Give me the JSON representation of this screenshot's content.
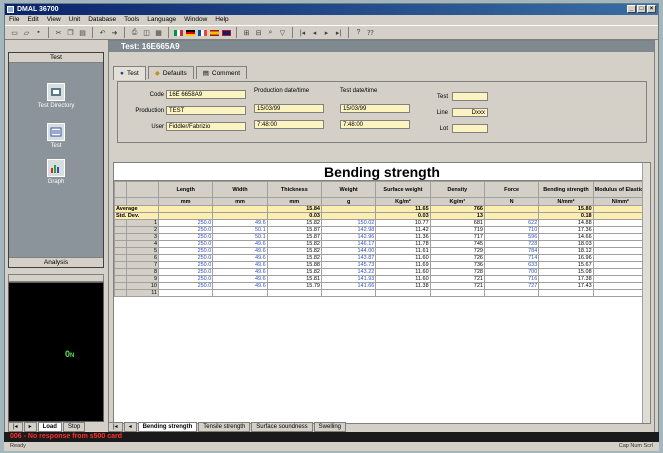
{
  "window": {
    "title": "DMAL 36700"
  },
  "menu": [
    "File",
    "Edit",
    "View",
    "Unit",
    "Database",
    "Tools",
    "Language",
    "Window",
    "Help"
  ],
  "sidebar": {
    "header": "Test",
    "items": [
      {
        "label": "Test Directory",
        "icon": "directory-icon"
      },
      {
        "label": "Test",
        "icon": "test-icon"
      },
      {
        "label": "Graph",
        "icon": "graph-icon"
      }
    ],
    "footer": "Analysis"
  },
  "monitor": {
    "value": "0",
    "unit": "N"
  },
  "left_tabs": [
    "Load",
    "Stop"
  ],
  "document": {
    "title": "Test: 16E665A9",
    "tabs": [
      {
        "label": "Test",
        "icon": "info-icon"
      },
      {
        "label": "Defaults",
        "icon": "defaults-icon"
      },
      {
        "label": "Comment",
        "icon": "comment-icon"
      }
    ],
    "form": {
      "code_label": "Code",
      "code_value": "16E 6658A9",
      "production_label": "Production",
      "production_value": "TEST",
      "user_label": "User",
      "user_value": "Fiddler/Fabrizio",
      "prod_date_label": "Production date/time",
      "prod_date": "15/03/99",
      "prod_time": "7:48:00",
      "test_date_label": "Test date/time",
      "test_date": "15/03/99",
      "test_time": "7:48:00",
      "test_label": "Test",
      "test_value": "",
      "line_label": "Line",
      "line_value": "Dxxx",
      "lot_label": "Lot",
      "lot_value": ""
    }
  },
  "grid": {
    "title": "Bending strength",
    "columns": [
      "Length",
      "Width",
      "Thickness",
      "Weight",
      "Surface weight",
      "Density",
      "Force",
      "Bending strength",
      "Modulus of Elasticity"
    ],
    "units": [
      "mm",
      "mm",
      "mm",
      "g",
      "Kg/m²",
      "Kg/m³",
      "N",
      "N/mm²",
      "N/mm²"
    ],
    "stats": [
      {
        "label": "Average",
        "values": [
          "",
          "",
          "15.84",
          "",
          "11.65",
          "766",
          "",
          "15.80",
          ""
        ]
      },
      {
        "label": "Std. Dev.",
        "values": [
          "",
          "",
          "0.03",
          "",
          "0.03",
          "13",
          "",
          "0.18",
          ""
        ]
      }
    ],
    "rows": [
      [
        "1",
        "250.0",
        "49.6",
        "15.82",
        "150.02",
        "10.77",
        "681",
        "622",
        "14.88",
        ""
      ],
      [
        "2",
        "250.0",
        "50.1",
        "15.87",
        "142.98",
        "11.42",
        "719",
        "710",
        "17.36",
        ""
      ],
      [
        "3",
        "250.0",
        "50.1",
        "15.87",
        "142.96",
        "11.36",
        "717",
        "596",
        "14.66",
        ""
      ],
      [
        "4",
        "250.0",
        "49.6",
        "15.82",
        "146.17",
        "11.78",
        "745",
        "728",
        "18.03",
        ""
      ],
      [
        "5",
        "250.0",
        "49.6",
        "15.82",
        "144.00",
        "11.61",
        "729",
        "784",
        "18.12",
        ""
      ],
      [
        "6",
        "250.0",
        "49.6",
        "15.82",
        "143.87",
        "11.60",
        "726",
        "714",
        "16.96",
        ""
      ],
      [
        "7",
        "250.0",
        "49.6",
        "15.88",
        "145.73",
        "11.69",
        "736",
        "633",
        "15.67",
        ""
      ],
      [
        "8",
        "250.0",
        "49.6",
        "15.82",
        "143.22",
        "11.60",
        "728",
        "700",
        "15.08",
        ""
      ],
      [
        "9",
        "250.0",
        "49.6",
        "15.81",
        "141.93",
        "11.60",
        "721",
        "716",
        "17.38",
        ""
      ],
      [
        "10",
        "250.0",
        "49.6",
        "15.79",
        "141.66",
        "11.38",
        "721",
        "727",
        "17.43",
        ""
      ],
      [
        "11",
        "",
        "",
        "",
        "",
        "",
        "",
        "",
        "",
        ""
      ]
    ]
  },
  "sheet_tabs": [
    "Bending strength",
    "Tensile strength",
    "Surface soundness",
    "Swelling"
  ],
  "status": {
    "error": "006 - No response from s500 card",
    "hint": "Ready",
    "right": "Cap  Num  Scrl"
  },
  "colors": {
    "stat_row": "#fbeeb0",
    "value_blue": "#3050c0",
    "error_text": "#ff3030"
  }
}
